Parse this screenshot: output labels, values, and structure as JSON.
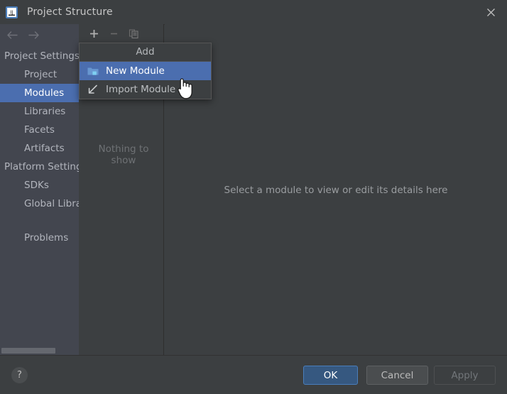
{
  "window": {
    "title": "Project Structure",
    "app_icon": "intellij-idea-icon",
    "close_label": "✕"
  },
  "sidebar": {
    "back_icon": "arrow-left-icon",
    "forward_icon": "arrow-right-icon",
    "items": [
      {
        "label": "Project Settings",
        "type": "group",
        "selected": false
      },
      {
        "label": "Project",
        "type": "child",
        "selected": false
      },
      {
        "label": "Modules",
        "type": "child",
        "selected": true
      },
      {
        "label": "Libraries",
        "type": "child",
        "selected": false
      },
      {
        "label": "Facets",
        "type": "child",
        "selected": false
      },
      {
        "label": "Artifacts",
        "type": "child",
        "selected": false
      },
      {
        "label": "Platform Settings",
        "type": "group",
        "selected": false
      },
      {
        "label": "SDKs",
        "type": "child",
        "selected": false
      },
      {
        "label": "Global Libraries",
        "type": "child",
        "selected": false
      },
      {
        "label": "Problems",
        "type": "child",
        "selected": false,
        "spaced": true
      }
    ],
    "scrollbar": "horizontal-scrollbar"
  },
  "modules_panel": {
    "toolbar": {
      "add_icon": "plus-icon",
      "remove_icon": "minus-icon",
      "copy_icon": "copy-icon"
    },
    "empty_text": "Nothing to show"
  },
  "details_panel": {
    "hint": "Select a module to view or edit its details here"
  },
  "popup_menu": {
    "title": "Add",
    "items": [
      {
        "label": "New Module",
        "icon": "folder-icon",
        "highlighted": true
      },
      {
        "label": "Import Module",
        "icon": "import-arrow-icon",
        "highlighted": false
      }
    ]
  },
  "footer": {
    "help_label": "?",
    "ok_label": "OK",
    "cancel_label": "Cancel",
    "apply_label": "Apply"
  },
  "colors": {
    "panel_bg": "#3c3f41",
    "sidebar_bg": "#43464f",
    "selection_blue": "#4b6eaf",
    "ok_button_bg": "#365880",
    "ok_button_border": "#4a7ebb",
    "text": "#bbbbbb",
    "muted_text": "#6e7174"
  }
}
